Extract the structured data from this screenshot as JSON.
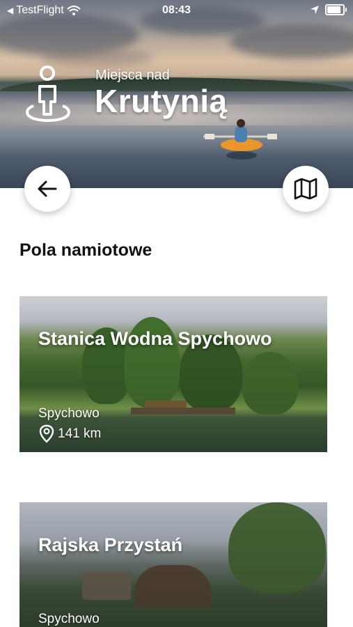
{
  "status_bar": {
    "carrier": "TestFlight",
    "time": "08:43"
  },
  "header": {
    "subtitle": "Miejsca nad",
    "title": "Krutynią"
  },
  "buttons": {
    "back_icon": "arrow-left-icon",
    "map_icon": "map-icon"
  },
  "section": {
    "title": "Pola namiotowe"
  },
  "cards": [
    {
      "title": "Stanica Wodna Spychowo",
      "location": "Spychowo",
      "distance": "141 km"
    },
    {
      "title": "Rajska Przystań",
      "location": "Spychowo"
    }
  ],
  "colors": {
    "text_dark": "#111111",
    "button_bg": "#ffffff"
  }
}
